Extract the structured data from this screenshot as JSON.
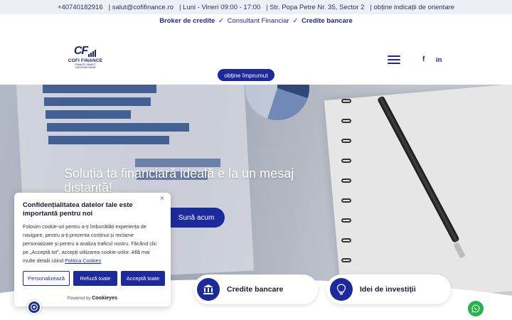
{
  "topbar": {
    "phone": "+40740182916",
    "email": "| salut@cofifinance.ro",
    "hours": "| Luni - Vineri 09:00 - 17:00",
    "address": "| Str. Popa Petre Nr. 35, Sector 2",
    "directions": "| obține indicații de orientare"
  },
  "tagline": {
    "part1": "Broker de credite",
    "check1": "✓",
    "part2": "Consultant Financiar",
    "check2": "✓",
    "part3": "Credite bancare"
  },
  "logo": {
    "mark": "CF",
    "name": "COFI FINANCE",
    "sub_line1": "FINANȚE SMART,",
    "sub_line2": "VIAȚĂ MAI BUNĂ"
  },
  "header": {
    "loan_button": "obține împrumut",
    "facebook_glyph": "f",
    "linkedin_glyph": "in"
  },
  "hero": {
    "title": "Soluția ta financiară ideală e la un mesaj distanță!",
    "call_button": "Sună acum"
  },
  "cards": [
    {
      "label": "Credite bancare",
      "icon": "bank-icon"
    },
    {
      "label": "Idei de investiții",
      "icon": "lightbulb-icon"
    }
  ],
  "cookie": {
    "close": "×",
    "title": "Confidențialitatea datelor tale este importantă pentru noi",
    "body": "Folosim cookie-uri pentru a-ți îmbunătăți experiența de navigare, pentru a-ți prezenta conținut și reclame personalizate și pentru a analiza traficul nostru. Făcând clic pe „Acceptă tot”, accepți utilizarea cookie-urilor. Află mai multe detalii citind",
    "policy_link": "Politica Cookies",
    "customize": "Personalizează",
    "reject": "Refuză toate",
    "accept": "Acceptă toate",
    "powered_prefix": "Powered by",
    "powered_brand": "Cookieyes"
  },
  "colors": {
    "brand": "#1d2a9e",
    "whatsapp": "#25b34b"
  }
}
